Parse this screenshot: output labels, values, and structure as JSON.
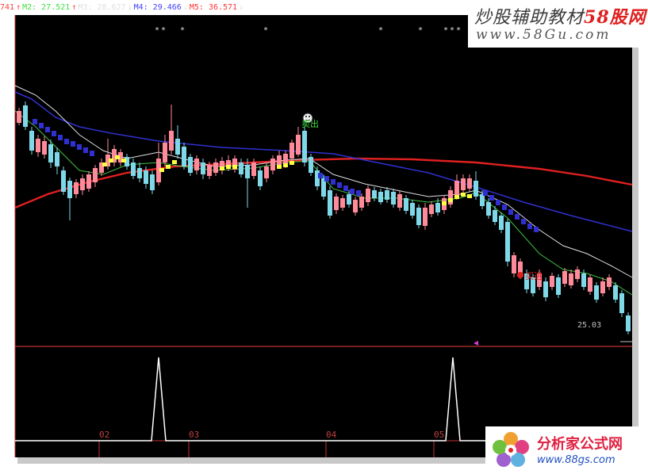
{
  "legend": [
    {
      "text": "741",
      "arrow": "↑",
      "color": "#ff4040",
      "arrow_color": "#ff4040"
    },
    {
      "text": "M2: 27.521",
      "arrow": "↑",
      "color": "#40e040",
      "arrow_color": "#ff4040"
    },
    {
      "text": "M3: 28.627",
      "arrow": "↓",
      "color": "#e0e0e0",
      "arrow_color": "#e0e0e0"
    },
    {
      "text": "M4: 29.466",
      "arrow": "↓",
      "color": "#4040ff",
      "arrow_color": "#e0e0e0"
    },
    {
      "text": "M5: 36.571",
      "arrow": "↓",
      "color": "#ff3030",
      "arrow_color": "#e0e0e0"
    }
  ],
  "signals": {
    "sell_label": "卖出",
    "buy_label": "买进",
    "price_tag": "25.03"
  },
  "x_axis": [
    "02",
    "03",
    "04",
    "05"
  ],
  "watermarks": {
    "top_line1": "炒股辅助教材",
    "top_line1_accent": "58股网",
    "top_line2": "www.58Gu.com",
    "bottom_line1": "分析家公式网",
    "bottom_line2": "www.88gs.com"
  },
  "colors": {
    "up_candle": "#ff8a9a",
    "down_candle": "#7fd8e8",
    "ma_blue": "#3030d0",
    "ma_red": "#e02020",
    "ma_white": "#e0e0e0",
    "ma_green": "#40c040",
    "ma_yellow": "#ffff40"
  },
  "icons": [
    "smiley-sell-icon",
    "buy-dot-icon",
    "star-markers"
  ]
}
